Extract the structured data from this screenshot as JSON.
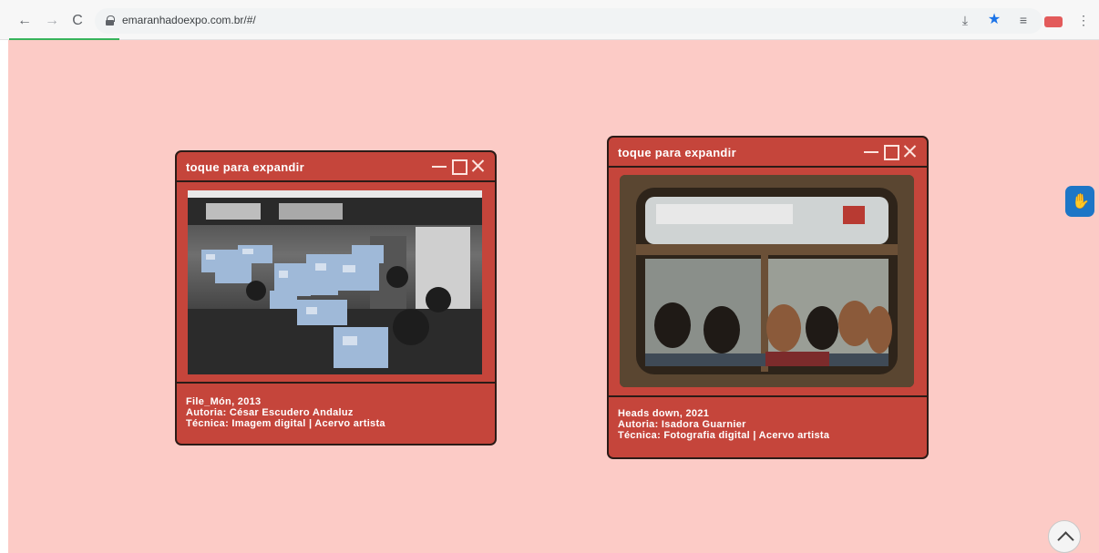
{
  "browser": {
    "url": "emaranhadoexpo.com.br/#/",
    "back_label": "←",
    "forward_label": "→",
    "reload_label": "C",
    "icons": [
      "install-icon",
      "star-icon",
      "reading-list-icon",
      "extension-icon",
      "menu-icon"
    ]
  },
  "page": {
    "background": "#fccbc6",
    "accent": "#c5453b"
  },
  "cards": [
    {
      "title": "toque para expandir",
      "caption_lines": [
        "File_Món, 2013",
        "Autoria: César Escudero Andaluz",
        "Técnica: Imagem digital | Acervo artista"
      ]
    },
    {
      "title": "toque para expandir",
      "caption_lines": [
        "Heads down, 2021",
        "Autoria: Isadora Guarnier",
        "Técnica: Fotografia digital | Acervo artista"
      ]
    }
  ]
}
